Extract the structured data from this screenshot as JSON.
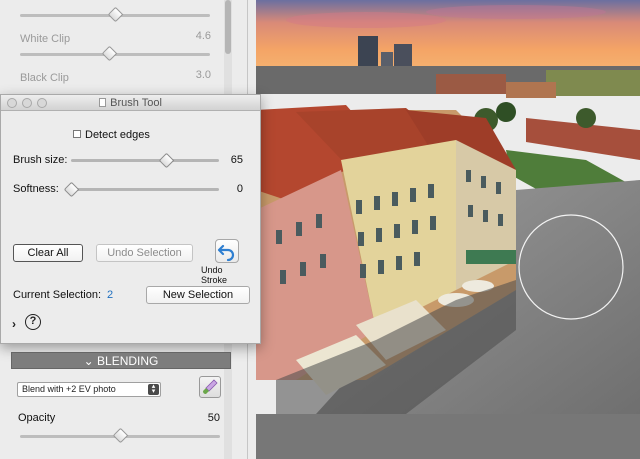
{
  "panel": {
    "white_clip": {
      "label": "White Clip",
      "value": "4.6",
      "position": 0.47
    },
    "black_clip": {
      "label": "Black Clip",
      "value": "3.0"
    },
    "top_slider": {
      "position": 0.5
    }
  },
  "window": {
    "title": "Brush Tool"
  },
  "brush": {
    "detect_edges": {
      "label": "Detect edges",
      "checked": false
    },
    "size": {
      "label": "Brush size:",
      "value": "65",
      "position": 0.64
    },
    "softness": {
      "label": "Softness:",
      "value": "0",
      "position": 0.0
    },
    "buttons": {
      "clear_all": "Clear All",
      "undo_selection": "Undo Selection",
      "undo_stroke": "Undo Stroke",
      "new_selection": "New Selection"
    },
    "current_selection": {
      "label": "Current Selection:",
      "value": "2"
    },
    "expand": "›",
    "help": "?"
  },
  "blending": {
    "header": "BLENDING",
    "mode": "Blend with +2 EV photo",
    "opacity": {
      "label": "Opacity",
      "value": "50",
      "position": 0.5
    }
  },
  "icons": {
    "undo": "undo-arrow-icon",
    "brush": "brush-icon",
    "chevron": "chevron-down-icon"
  },
  "colors": {
    "accent": "#1f6fbf",
    "header_bg": "#7d7d7d"
  }
}
